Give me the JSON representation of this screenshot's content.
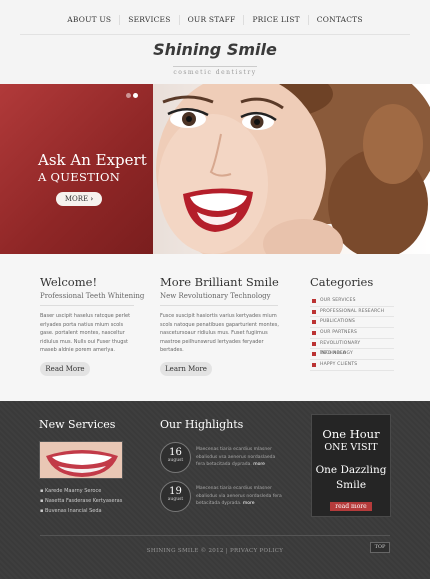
{
  "nav": {
    "items": [
      "ABOUT US",
      "SERVICES",
      "OUR STAFF",
      "PRICE LIST",
      "CONTACTS"
    ]
  },
  "logo": {
    "title": "Shining Smile",
    "subtitle": "cosmetic dentistry"
  },
  "hero": {
    "heading": "Ask An Expert",
    "subheading": "A QUESTION",
    "button_label": "MORE",
    "button_icon": "chevron-right-icon",
    "slide_count": 2,
    "active_slide": 2,
    "colors": {
      "panel": "#9e2e2e"
    }
  },
  "welcome": {
    "title": "Welcome!",
    "subtitle": "Professional Teeth Whitening",
    "text": "Baser uscipit haselus ratcque perlet erlyades porta natius mium scols gase. portalent montes, nasceltur ridiulus mus. Nulls oui Fuser thugst maseb aldnie porem amerlya.",
    "button_label": "Read More"
  },
  "brilliant": {
    "title": "More Brilliant Smile",
    "subtitle": "New Revolutionary Technology",
    "text": "Fusce suscipit hasiortis varius kertyades mium scols natoque penatibues gaparturient montes, nascetursoaur ridiulus mus. Fuset fugiimus mastroe peilhunswrud lertyades feryader bertades.",
    "button_label": "Learn More"
  },
  "categories": {
    "title": "Categories",
    "items": [
      "OUR SERVICES",
      "PROFESSIONAL RESEARCH",
      "PUBLICATIONS",
      "OUR PARTNERS",
      "REVOLUTIONARY TECHNOLOGY",
      "INFO AREA",
      "HAPPY CLIENTS"
    ],
    "colors": {
      "bullet": "#b33333"
    }
  },
  "new_services": {
    "title": "New Services",
    "items": [
      "Karede Maarny Seroce",
      "Nasetta Fasderase Kertyaseras",
      "Buvenas Inancial Seda"
    ]
  },
  "highlights": {
    "title": "Our Highlights",
    "items": [
      {
        "day": "16",
        "month": "august",
        "text": "Maecenas tiaria ecardius mlasner ebalisdus vsa aenerus nordaslaeda fera betacitada dyprada.",
        "more": "more"
      },
      {
        "day": "19",
        "month": "august",
        "text": "Maecenas tiaria ecardius mlasner ebalisdus via aenerus nordasleda fera betacitada dyprada.",
        "more": "more"
      }
    ]
  },
  "promo": {
    "line1": "One Hour",
    "line2": "ONE VISIT",
    "line3": "One Dazzling Smile",
    "button_label": "read more"
  },
  "footer": {
    "copyright": "SHINING SMILE © 2012  |  PRIVACY POLICY",
    "top_label": "TOP"
  }
}
